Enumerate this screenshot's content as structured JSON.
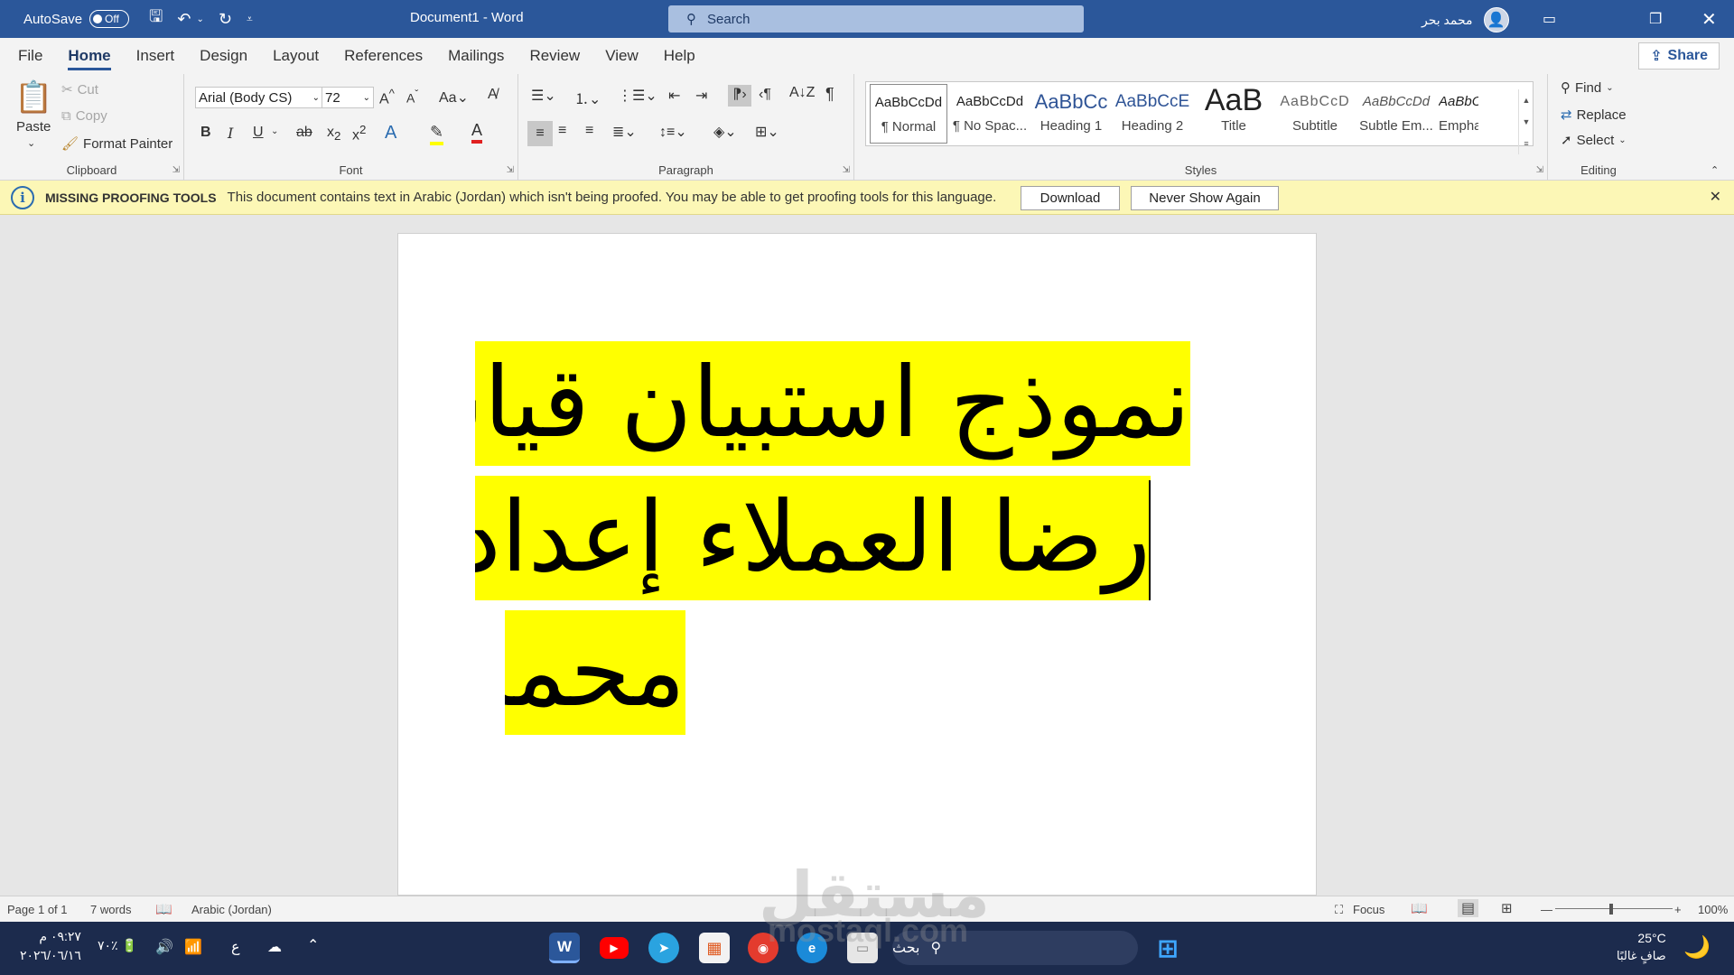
{
  "titlebar": {
    "autosave_label": "AutoSave",
    "autosave_state": "Off",
    "doc_title": "Document1  -  Word",
    "search_placeholder": "Search",
    "user_name": "محمد بحر"
  },
  "tabs": [
    "File",
    "Home",
    "Insert",
    "Design",
    "Layout",
    "References",
    "Mailings",
    "Review",
    "View",
    "Help"
  ],
  "active_tab": "Home",
  "share_label": "Share",
  "clipboard": {
    "paste": "Paste",
    "cut": "Cut",
    "copy": "Copy",
    "format_painter": "Format Painter",
    "label": "Clipboard"
  },
  "font": {
    "font_name": "Arial (Body CS)",
    "font_size": "72",
    "label": "Font"
  },
  "paragraph": {
    "label": "Paragraph"
  },
  "styles": {
    "items": [
      {
        "sample": "AaBbCcDd",
        "name": "¶ Normal"
      },
      {
        "sample": "AaBbCcDd",
        "name": "¶ No Spac..."
      },
      {
        "sample": "AaBbCc",
        "name": "Heading 1"
      },
      {
        "sample": "AaBbCcE",
        "name": "Heading 2"
      },
      {
        "sample": "AaB",
        "name": "Title"
      },
      {
        "sample": "AaBbCcD",
        "name": "Subtitle"
      },
      {
        "sample": "AaBbCcDd",
        "name": "Subtle Em..."
      },
      {
        "sample": "AaBbCcDd",
        "name": "Emphasis"
      }
    ],
    "label": "Styles"
  },
  "editing": {
    "find": "Find",
    "replace": "Replace",
    "select": "Select",
    "label": "Editing"
  },
  "message_bar": {
    "title": "MISSING PROOFING TOOLS",
    "text": "This document contains text in Arabic (Jordan) which isn't being proofed. You may be able to get proofing tools for this language.",
    "download": "Download",
    "never_show": "Never Show Again"
  },
  "document": {
    "lines": [
      "نموذج استبيان قياس",
      "رضا العملاء إعداد",
      "محمد"
    ]
  },
  "status": {
    "page": "Page 1 of 1",
    "words": "7 words",
    "language": "Arabic (Jordan)",
    "focus": "Focus",
    "zoom": "100%"
  },
  "taskbar": {
    "time": "٠٩:٢٧ م",
    "date": "٢٠٢٦/٠٦/١٦",
    "battery": "٧٠٪",
    "input_lang": "ع",
    "search": "بحث",
    "temperature": "25°C",
    "weather": "صافٍ غالبًا"
  },
  "watermark": {
    "text": "مستقل",
    "sub": "mostaql.com"
  },
  "colors": {
    "word_blue": "#2b579a",
    "highlight": "#ffff00",
    "message_bar": "#fcf7b6",
    "taskbar": "#1c2b4d"
  }
}
